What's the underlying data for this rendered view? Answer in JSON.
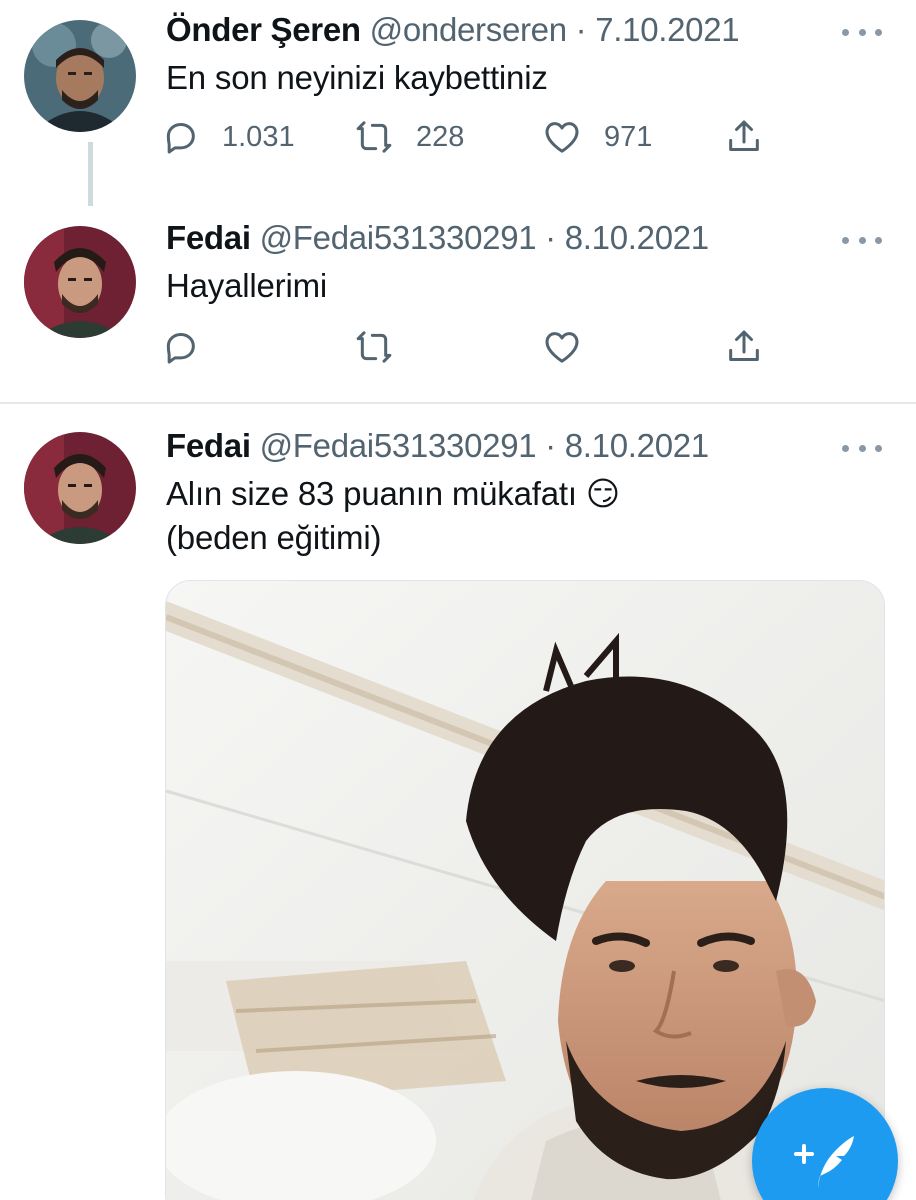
{
  "tweets": [
    {
      "display_name": "Önder Şeren",
      "handle": "@onderseren",
      "date": "7.10.2021",
      "text_lines": [
        "En son neyinizi kaybettiniz"
      ],
      "replies": "1.031",
      "retweets": "228",
      "likes": "971"
    },
    {
      "display_name": "Fedai",
      "handle": "@Fedai531330291",
      "date": "8.10.2021",
      "text_lines": [
        "Hayallerimi"
      ]
    },
    {
      "display_name": "Fedai",
      "handle": "@Fedai531330291",
      "date": "8.10.2021",
      "text_lines": [
        "Alın size 83 puanın mükafatı 😏",
        "(beden eğitimi)"
      ]
    }
  ],
  "separator": " · ",
  "icons": {
    "reply": "reply-icon",
    "retweet": "retweet-icon",
    "like": "heart-icon",
    "share": "share-icon",
    "more": "more-icon",
    "compose": "compose-tweet-icon"
  },
  "colors": {
    "text": "#0f1419",
    "secondary": "#536471",
    "accent": "#1d9bf0",
    "divider": "#e4e8eb"
  }
}
